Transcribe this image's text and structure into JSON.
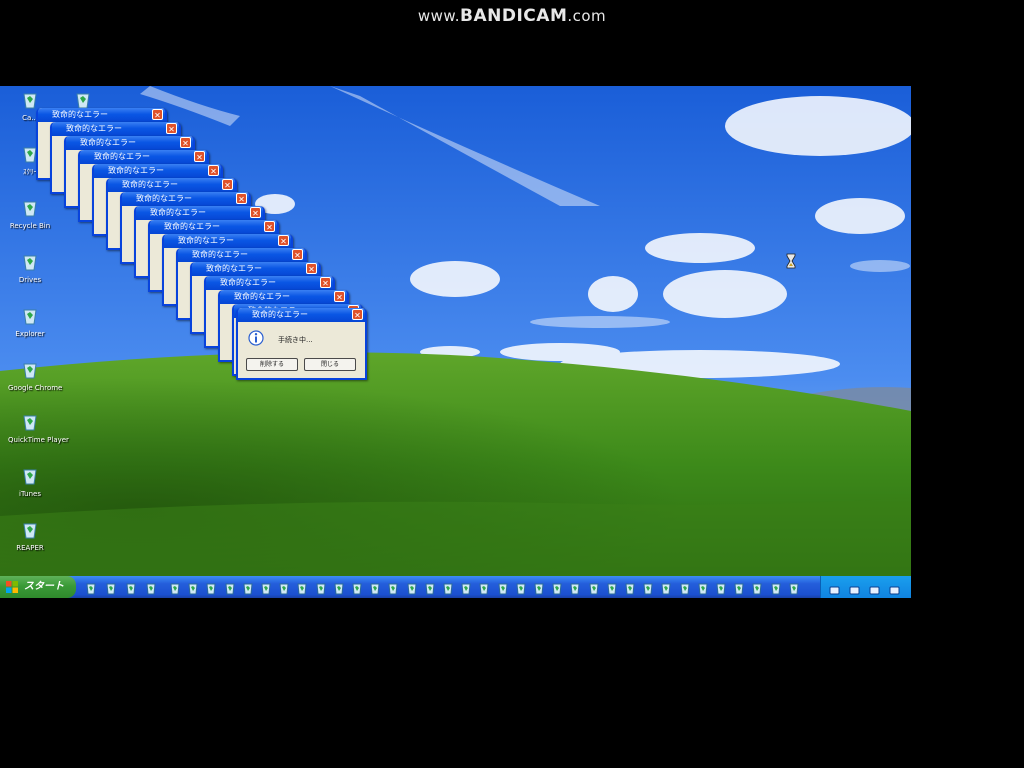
{
  "watermark": {
    "prefix": "www.",
    "brand": "BANDICAM",
    "suffix": ".com"
  },
  "desktop": {
    "icons": [
      {
        "label": "Ca..."
      },
      {
        "label": "ｽｸﾘｰ"
      },
      {
        "label": "Recycle Bin"
      },
      {
        "label": "Drives"
      },
      {
        "label": "Explorer"
      },
      {
        "label": "Google Chrome"
      },
      {
        "label": "QuickTime Player"
      },
      {
        "label": "iTunes"
      },
      {
        "label": "REAPER"
      }
    ]
  },
  "error_dialog": {
    "title": "致命的なエラー",
    "message": "手続き中...",
    "buttons": {
      "primary": "削除する",
      "secondary": "閉じる"
    },
    "count": 16
  },
  "taskbar": {
    "start_label": "スタート",
    "quick_launch_count": 4,
    "task_count": 35,
    "tray_count": 4
  },
  "colors": {
    "titlebar": "#0a56e4",
    "dialog_body": "#ece9d8",
    "taskbar": "#245edb",
    "start": "#3a9a37"
  }
}
